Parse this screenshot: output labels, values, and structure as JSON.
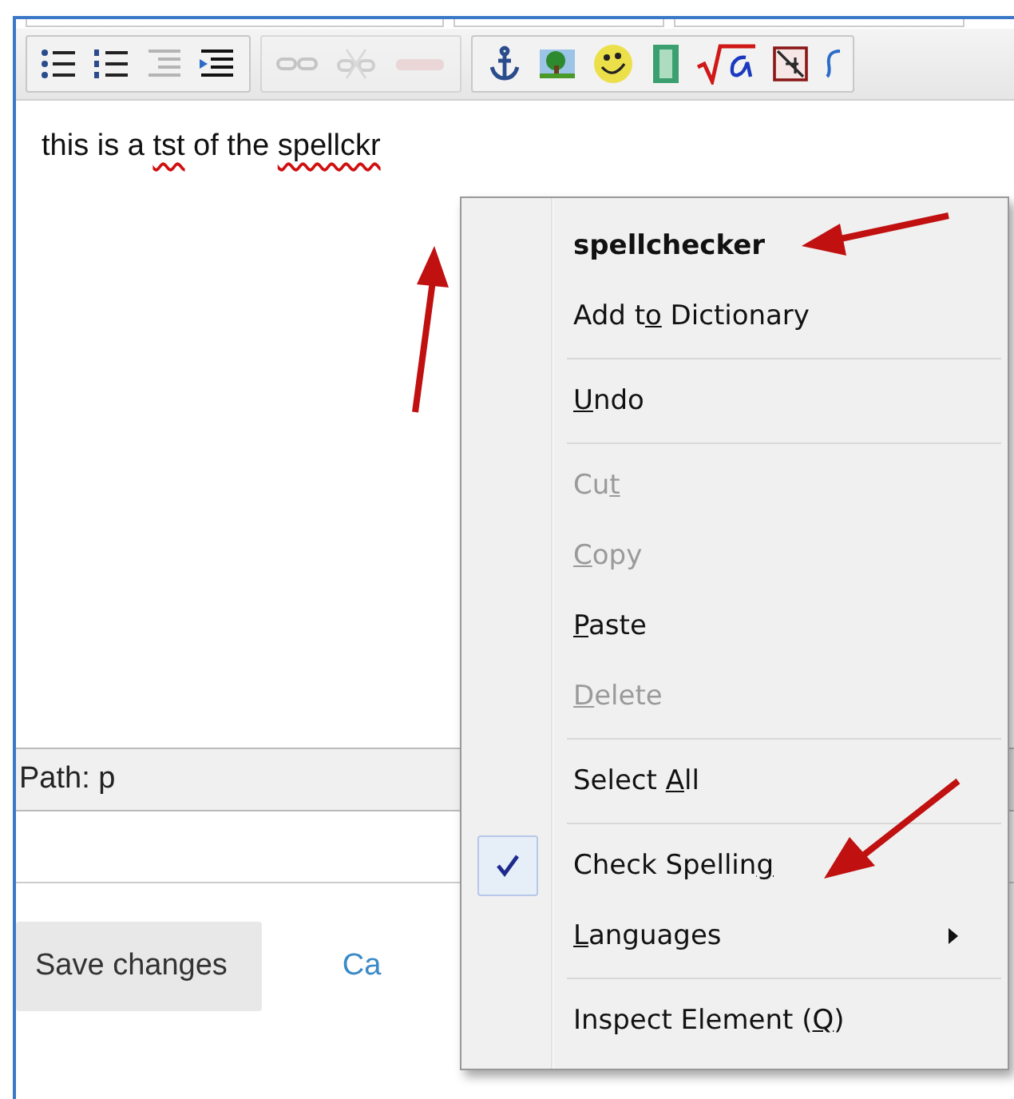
{
  "toolbar": {
    "groups": [
      {
        "kind": "lists",
        "disabled": false
      },
      {
        "kind": "links",
        "disabled": true
      },
      {
        "kind": "insert",
        "disabled": false
      }
    ]
  },
  "editor": {
    "segments": [
      {
        "text": "this is a ",
        "misspelled": false
      },
      {
        "text": "tst",
        "misspelled": true
      },
      {
        "text": " of the ",
        "misspelled": false
      },
      {
        "text": "spellckr",
        "misspelled": true
      }
    ]
  },
  "path_bar": {
    "label": "Path: p"
  },
  "save_button": {
    "label": "Save changes"
  },
  "cancel_link": {
    "label": "Ca"
  },
  "context_menu": {
    "items": [
      {
        "kind": "suggestion",
        "label": "spellchecker",
        "disabled": false
      },
      {
        "kind": "item",
        "before": "Add t",
        "access_key": "o",
        "after": " Dictionary",
        "disabled": false
      },
      {
        "kind": "separator"
      },
      {
        "kind": "item",
        "access_key": "U",
        "after": "ndo",
        "disabled": false
      },
      {
        "kind": "separator"
      },
      {
        "kind": "item",
        "before": "Cu",
        "access_key": "t",
        "disabled": true
      },
      {
        "kind": "item",
        "access_key": "C",
        "after": "opy",
        "disabled": true
      },
      {
        "kind": "item",
        "access_key": "P",
        "after": "aste",
        "disabled": false
      },
      {
        "kind": "item",
        "access_key": "D",
        "after": "elete",
        "disabled": true
      },
      {
        "kind": "separator"
      },
      {
        "kind": "item",
        "before": "Select ",
        "access_key": "A",
        "after": "ll",
        "disabled": false
      },
      {
        "kind": "separator"
      },
      {
        "kind": "item",
        "before": "Check Spellin",
        "access_key": "g",
        "disabled": false,
        "checked": true
      },
      {
        "kind": "item",
        "access_key": "L",
        "after": "anguages",
        "disabled": false,
        "submenu": true
      },
      {
        "kind": "separator"
      },
      {
        "kind": "item",
        "before": "Inspect Element (",
        "access_key": "Q",
        "after": ")",
        "disabled": false
      }
    ]
  }
}
